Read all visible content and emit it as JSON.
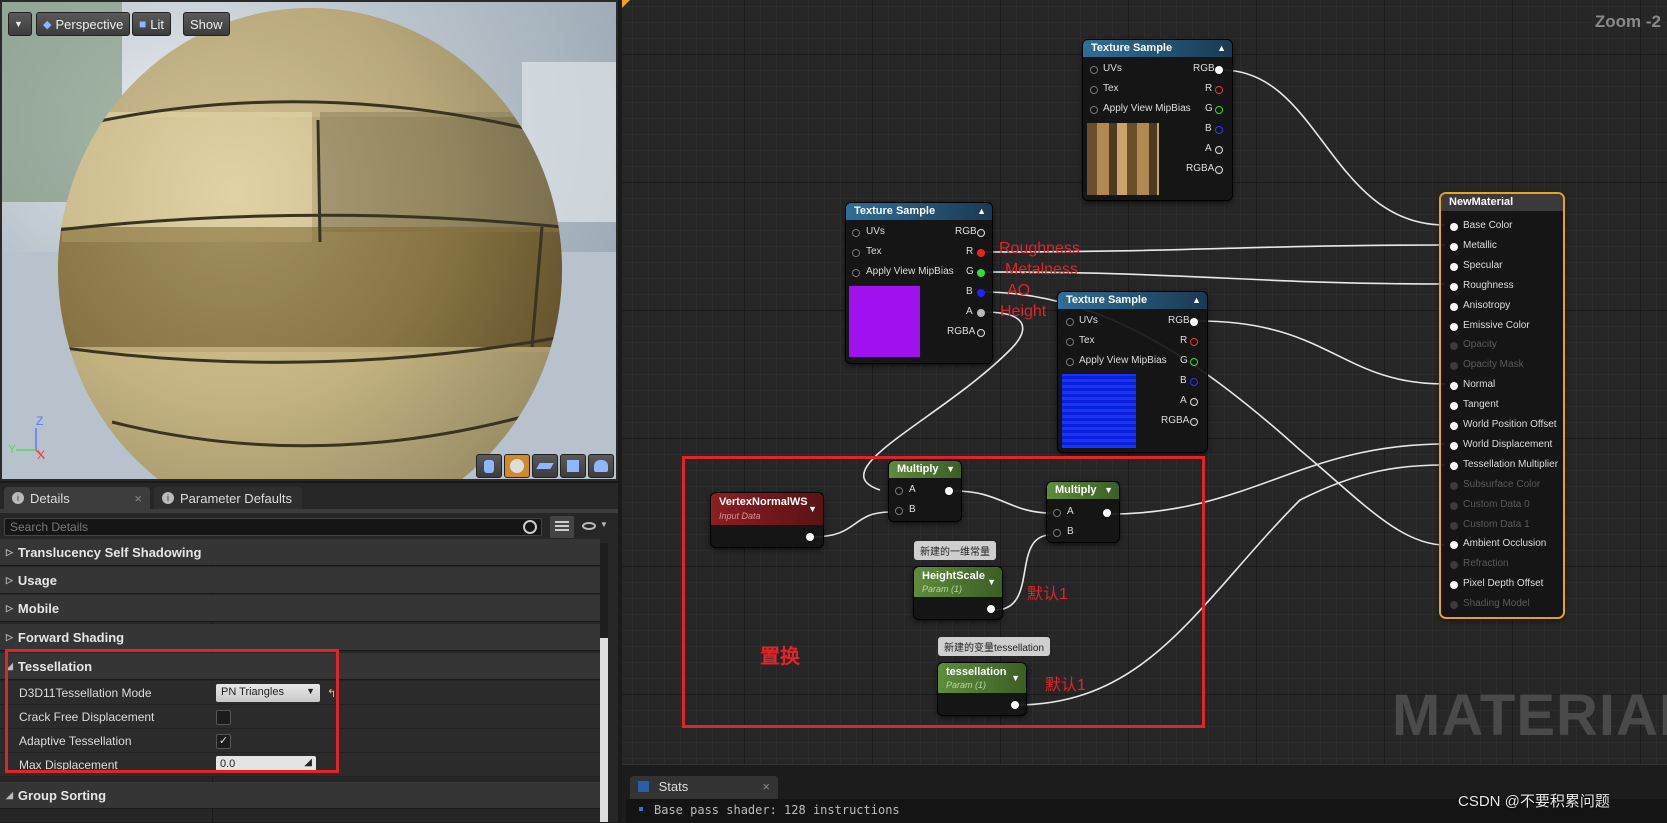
{
  "viewport": {
    "perspective_label": "Perspective",
    "lit_label": "Lit",
    "show_label": "Show",
    "axis_z": "Z",
    "axis_y": "Y",
    "axis_x": "X"
  },
  "details": {
    "tabs": [
      {
        "label": "Details",
        "close": "×"
      },
      {
        "label": "Parameter Defaults"
      }
    ],
    "search_placeholder": "Search Details",
    "categories": {
      "translucency": "Translucency Self Shadowing",
      "usage": "Usage",
      "mobile": "Mobile",
      "forward": "Forward Shading",
      "tessellation": "Tessellation",
      "group_sorting": "Group Sorting"
    },
    "props": {
      "d3d11_label": "D3D11Tessellation Mode",
      "d3d11_value": "PN Triangles",
      "crack_label": "Crack Free Displacement",
      "crack_checked": false,
      "adaptive_label": "Adaptive Tessellation",
      "adaptive_checked": true,
      "maxdisp_label": "Max Displacement",
      "maxdisp_value": "0.0"
    }
  },
  "graph": {
    "zoom_label": "Zoom -2",
    "watermark": "MATERIAL",
    "tex1": {
      "title": "Texture Sample",
      "inputs": [
        "UVs",
        "Tex",
        "Apply View MipBias"
      ],
      "outputs": [
        "RGB",
        "R",
        "G",
        "B",
        "A",
        "RGBA"
      ]
    },
    "tex2": {
      "title": "Texture Sample",
      "inputs": [
        "UVs",
        "Tex",
        "Apply View MipBias"
      ],
      "outputs": [
        "RGB",
        "R",
        "G",
        "B",
        "A",
        "RGBA"
      ]
    },
    "tex3": {
      "title": "Texture Sample",
      "inputs": [
        "UVs",
        "Tex",
        "Apply View MipBias"
      ],
      "outputs": [
        "RGB",
        "R",
        "G",
        "B",
        "A",
        "RGBA"
      ]
    },
    "annotations": {
      "roughness": "Roughness",
      "metalness": "Metalness",
      "ao": "AO",
      "height": "Height",
      "replace": "置换",
      "default1a": "默认1",
      "default1b": "默认1"
    },
    "vertex_normal": {
      "title": "VertexNormalWS",
      "subtitle": "Input Data"
    },
    "multiply1": {
      "title": "Multiply",
      "a": "A",
      "b": "B"
    },
    "multiply2": {
      "title": "Multiply",
      "a": "A",
      "b": "B"
    },
    "height_scale": {
      "title": "HeightScale",
      "subtitle": "Param (1)",
      "comment": "新建的一维常量"
    },
    "tessellation": {
      "title": "tessellation",
      "subtitle": "Param (1)",
      "comment": "新建的变量tessellation"
    },
    "material": {
      "title": "NewMaterial",
      "pins": [
        {
          "label": "Base Color",
          "enabled": true
        },
        {
          "label": "Metallic",
          "enabled": true
        },
        {
          "label": "Specular",
          "enabled": true
        },
        {
          "label": "Roughness",
          "enabled": true
        },
        {
          "label": "Anisotropy",
          "enabled": true
        },
        {
          "label": "Emissive Color",
          "enabled": true
        },
        {
          "label": "Opacity",
          "enabled": false
        },
        {
          "label": "Opacity Mask",
          "enabled": false
        },
        {
          "label": "Normal",
          "enabled": true
        },
        {
          "label": "Tangent",
          "enabled": true
        },
        {
          "label": "World Position Offset",
          "enabled": true
        },
        {
          "label": "World Displacement",
          "enabled": true
        },
        {
          "label": "Tessellation Multiplier",
          "enabled": true
        },
        {
          "label": "Subsurface Color",
          "enabled": false
        },
        {
          "label": "Custom Data 0",
          "enabled": false
        },
        {
          "label": "Custom Data 1",
          "enabled": false
        },
        {
          "label": "Ambient Occlusion",
          "enabled": true
        },
        {
          "label": "Refraction",
          "enabled": false
        },
        {
          "label": "Pixel Depth Offset",
          "enabled": true
        },
        {
          "label": "Shading Model",
          "enabled": false
        }
      ]
    }
  },
  "stats": {
    "tab_label": "Stats",
    "tab_close": "×",
    "line": "Base pass shader: 128 instructions"
  },
  "credit": "CSDN @不要积累问题",
  "colors": {
    "annotation_red": "#e0242a",
    "highlight_box": "#e0242a",
    "material_border": "#e8a21c"
  }
}
